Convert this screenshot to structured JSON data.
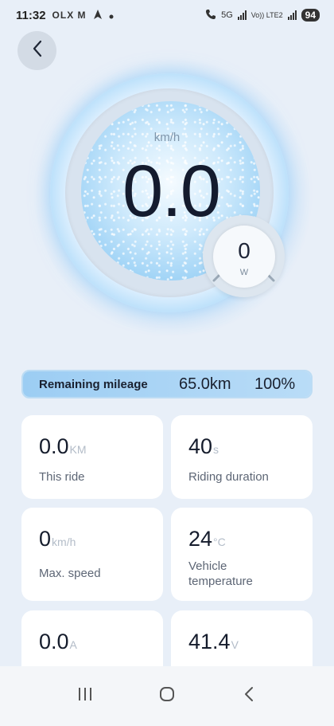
{
  "status_bar": {
    "time": "11:32",
    "left_icons": "OLX M",
    "network_label_1": "5G",
    "network_label_2": "Vo)) LTE2",
    "battery": "94"
  },
  "header": {
    "back_icon": "chevron-left-icon"
  },
  "speedometer": {
    "unit": "km/h",
    "value": "0.0"
  },
  "power": {
    "value": "0",
    "unit": "W"
  },
  "remaining": {
    "label": "Remaining mileage",
    "distance": "65.0km",
    "percent": "100%",
    "fraction": 1.0
  },
  "stats": [
    {
      "value": "0.0",
      "unit": "KM",
      "label": "This ride"
    },
    {
      "value": "40",
      "unit": "s",
      "label": "Riding duration"
    },
    {
      "value": "0",
      "unit": "km/h",
      "label": "Max. speed"
    },
    {
      "value": "24",
      "unit": "°C",
      "label": "Vehicle temperature"
    },
    {
      "value": "0.0",
      "unit": "A",
      "label": ""
    },
    {
      "value": "41.4",
      "unit": "V",
      "label": ""
    }
  ],
  "nav": {
    "recents_icon": "recent-apps-icon",
    "home_icon": "home-icon",
    "back_icon": "back-icon"
  },
  "colors": {
    "background": "#e8eff8",
    "accent": "#9ccdf3",
    "text_dark": "#151c2c"
  }
}
